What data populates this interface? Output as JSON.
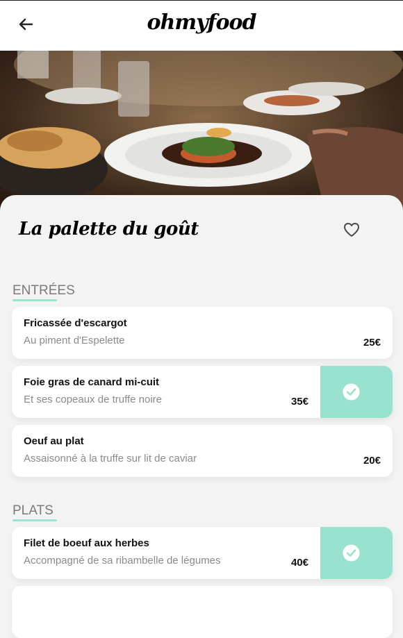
{
  "header": {
    "logo": "ohmyfood",
    "back_icon": "arrow-left-icon"
  },
  "hero": {
    "image": "restaurant-dish-photo"
  },
  "restaurant": {
    "name": "La palette du goût",
    "favorite_icon": "heart-outline-icon"
  },
  "sections": [
    {
      "title": "ENTRÉES",
      "items": [
        {
          "name": "Fricassée d'escargot",
          "description": "Au piment d'Espelette",
          "price": "25€",
          "selected": false
        },
        {
          "name": "Foie gras de canard mi-cuit",
          "description": "Et ses copeaux de truffe noire",
          "price": "35€",
          "selected": true
        },
        {
          "name": "Oeuf au plat",
          "description": "Assaisonné à la truffe sur lit de caviar",
          "price": "20€",
          "selected": false
        }
      ]
    },
    {
      "title": "PLATS",
      "items": [
        {
          "name": "Filet de boeuf aux herbes",
          "description": "Accompagné de sa ribambelle de légumes",
          "price": "40€",
          "selected": true
        }
      ]
    }
  ],
  "colors": {
    "accent": "#99e2d0",
    "background": "#f3f3f3"
  }
}
